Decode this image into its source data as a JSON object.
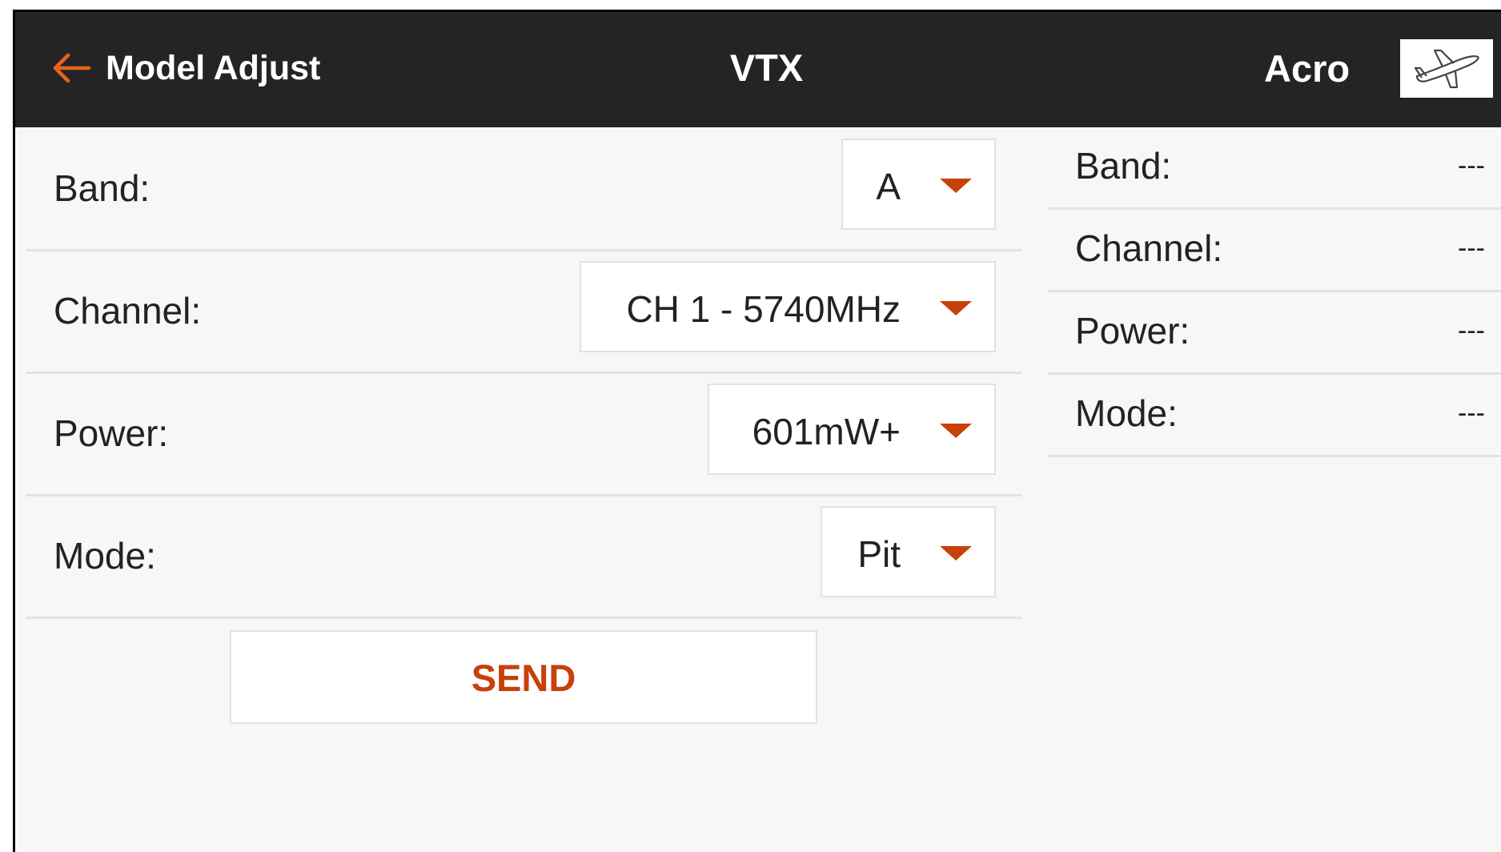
{
  "header": {
    "back_label": "Model Adjust",
    "title": "VTX",
    "flight_mode": "Acro",
    "back_icon": "arrow-left-icon",
    "model_icon": "airplane-icon",
    "accent_color": "#c8400a"
  },
  "settings": {
    "band": {
      "label": "Band:",
      "value": "A"
    },
    "channel": {
      "label": "Channel:",
      "value": "CH 1 - 5740MHz"
    },
    "power": {
      "label": "Power:",
      "value": "601mW+"
    },
    "mode": {
      "label": "Mode:",
      "value": "Pit"
    }
  },
  "send_label": "SEND",
  "status": {
    "band": {
      "label": "Band:",
      "value": "---"
    },
    "channel": {
      "label": "Channel:",
      "value": "---"
    },
    "power": {
      "label": "Power:",
      "value": "---"
    },
    "mode": {
      "label": "Mode:",
      "value": "---"
    }
  }
}
